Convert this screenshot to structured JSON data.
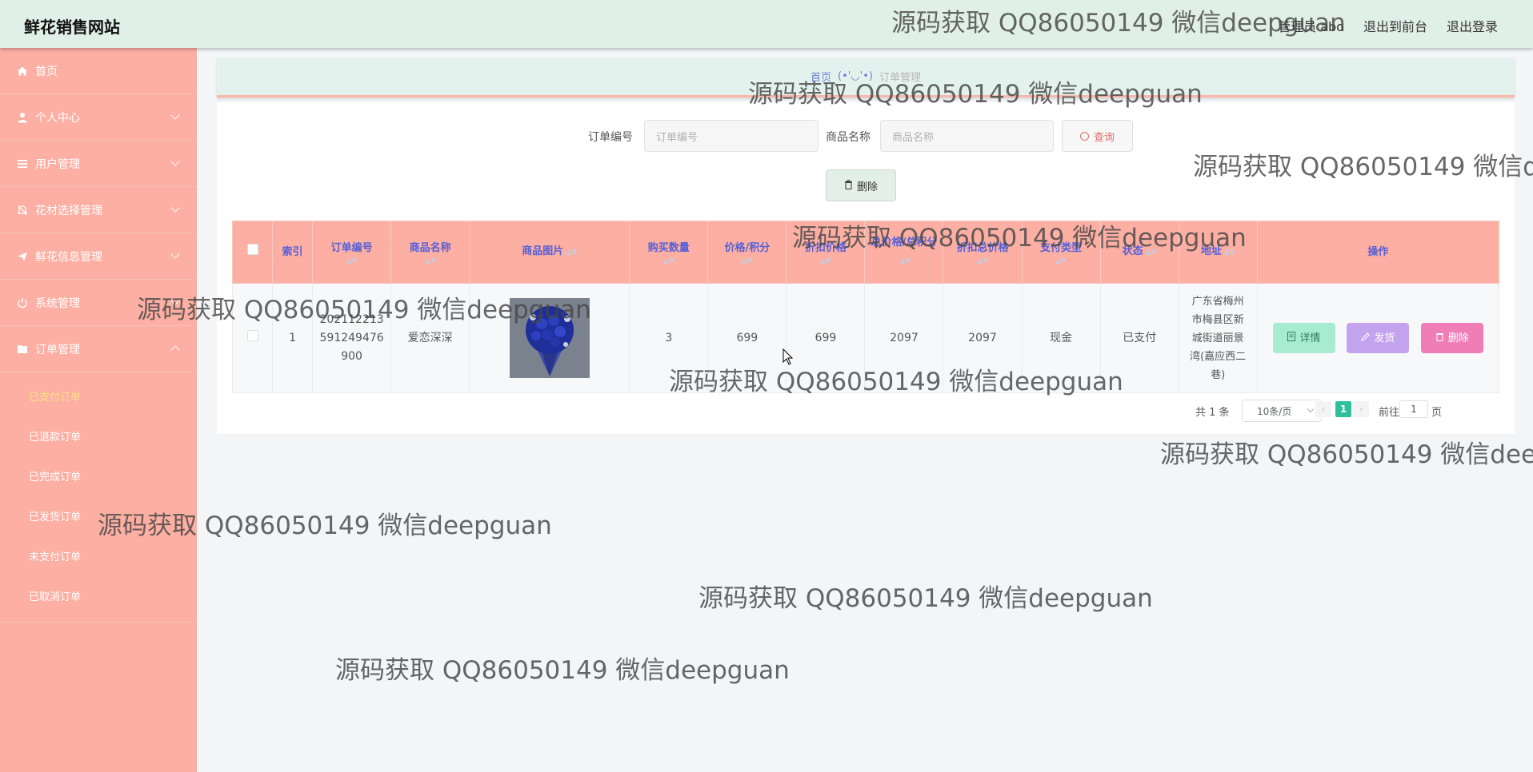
{
  "header": {
    "brand": "鲜花销售网站",
    "admin": "管理员 abo",
    "front": "退出到前台",
    "logout": "退出登录"
  },
  "sidebar": {
    "items": [
      {
        "label": "首页",
        "icon": "home-icon"
      },
      {
        "label": "个人中心",
        "icon": "user-icon"
      },
      {
        "label": "用户管理",
        "icon": "list-icon"
      },
      {
        "label": "花材选择管理",
        "icon": "bell-off-icon"
      },
      {
        "label": "鲜花信息管理",
        "icon": "send-icon"
      },
      {
        "label": "系统管理",
        "icon": "power-icon"
      },
      {
        "label": "订单管理",
        "icon": "folder-icon"
      }
    ],
    "order_sub": [
      "已支付订单",
      "已退款订单",
      "已完成订单",
      "已发货订单",
      "未支付订单",
      "已取消订单"
    ]
  },
  "breadcrumb": {
    "home": "首页",
    "face": "(•'◡'•)",
    "current": "订单管理"
  },
  "search": {
    "order_no_label": "订单编号",
    "order_no_placeholder": "订单编号",
    "product_label": "商品名称",
    "product_placeholder": "商品名称",
    "query": "查询",
    "delete": "删除"
  },
  "table": {
    "headers": [
      "索引",
      "订单编号",
      "商品名称",
      "商品图片",
      "购买数量",
      "价格/积分",
      "折扣价格",
      "总价格/总积分",
      "折扣总价格",
      "支付类型",
      "状态",
      "地址",
      "操作"
    ],
    "rows": [
      {
        "index": "1",
        "order_no": "202112213591249476900",
        "order_no_lines": [
          "202112213",
          "591249476",
          "900"
        ],
        "product": "爱恋深深",
        "qty": "3",
        "price": "699",
        "discount_price": "699",
        "total": "2097",
        "discount_total": "2097",
        "pay_type": "现金",
        "status": "已支付",
        "address": "广东省梅州市梅县区新城街道丽景湾(嘉应西二巷)",
        "address_lines": [
          "广东省梅州",
          "市梅县区新",
          "城街道丽景",
          "湾(嘉应西二",
          "巷)"
        ]
      }
    ],
    "actions": {
      "detail": "详情",
      "ship": "发货",
      "delete": "删除"
    }
  },
  "pagination": {
    "total": "共 1 条",
    "page_size": "10条/页",
    "current": "1",
    "goto_prefix": "前往",
    "goto_value": "1",
    "goto_suffix": "页"
  },
  "watermark": "源码获取 QQ86050149 微信deepguan",
  "colors": {
    "topbar": "#e1efe9",
    "sidebar": "#fdafa3",
    "header_text": "#5560d8",
    "active_sub": "#ffe082",
    "detail_btn": "#a7ecd0",
    "ship_btn": "#c4a3ee",
    "delete_btn": "#ef7eb6",
    "page_active": "#2fbf9c"
  }
}
